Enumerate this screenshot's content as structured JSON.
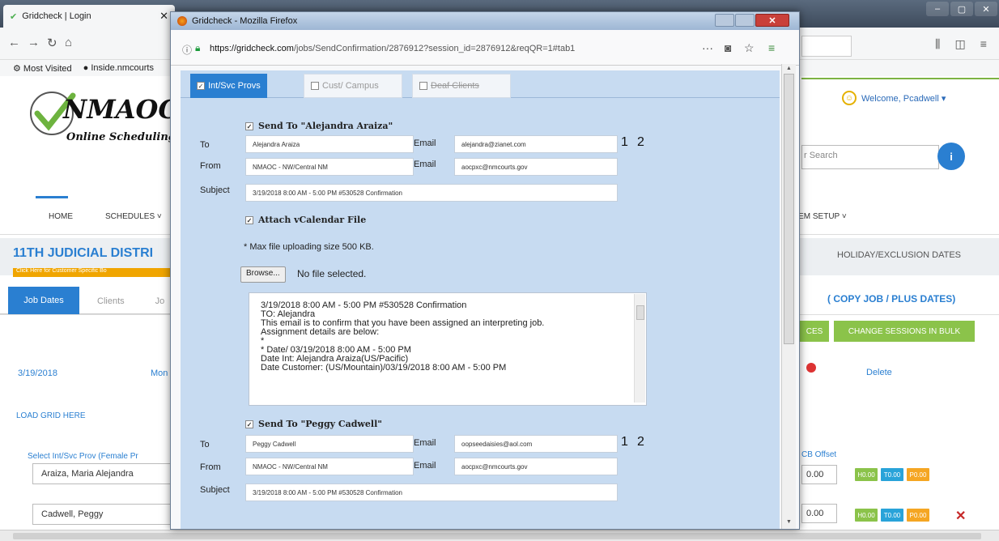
{
  "background": {
    "tab_title": "Gridcheck | Login",
    "tab_close": "✕",
    "bookmarks": [
      "Most Visited",
      "Inside.nmcourts"
    ],
    "logo_text": "NMAOC",
    "logo_tagline": "Online Scheduling &",
    "welcome": "Welcome, Pcadwell ▾",
    "search_placeholder": "r Search",
    "search_btn": "i",
    "menu": {
      "home": "HOME",
      "schedules": "SCHEDULES ˅",
      "system_setup": "TEM SETUP ˅"
    },
    "court_title": "11TH JUDICIAL DISTRI",
    "court_sub": "Click Here for Customer Specific Bo",
    "holiday": "HOLIDAY/EXCLUSION DATES",
    "tabs": {
      "job_dates": "Job Dates",
      "clients": "Clients",
      "more": "Jo"
    },
    "copy_job": "( COPY JOB / PLUS DATES)",
    "btn_ces": "CES",
    "btn_change_sessions": "CHANGE SESSIONS IN BULK",
    "row_date": "3/19/2018",
    "row_day": "Mon",
    "delete": "Delete",
    "load_grid": "LOAD GRID HERE",
    "select_prov": "Select Int/Svc Prov (Female Pr",
    "provider1": "Araiza, Maria Alejandra",
    "provider2": "Cadwell, Peggy",
    "cb_offset": "CB Offset",
    "offset1": "0.00",
    "offset2": "0.00",
    "pills": [
      "H0.00",
      "T0.00",
      "P0.00"
    ]
  },
  "popup": {
    "window_title": "Gridcheck - Mozilla Firefox",
    "url_host": "https://gridcheck.com",
    "url_path": "/jobs/SendConfirmation/2876912?session_id=2876912&reqQR=1#tab1",
    "url_more": "···",
    "tabs": [
      {
        "label": "Int/Svc Provs",
        "checked": true
      },
      {
        "label": "Cust/ Campus",
        "checked": false
      },
      {
        "label": "Deaf Clients",
        "checked": false
      }
    ],
    "labels": {
      "to": "To",
      "from": "From",
      "subject": "Subject",
      "email": "Email"
    },
    "recipient1": {
      "section": "Send To \"Alejandra Araiza\"",
      "to": "Alejandra Araiza",
      "to_email": "alejandra@zianet.com",
      "from": "NMAOC - NW/Central NM",
      "from_email": "aocpxc@nmcourts.gov",
      "subject": "3/19/2018 8:00 AM - 5:00 PM #530528 Confirmation"
    },
    "attach": "Attach vCalendar File",
    "max_size": "* Max file uploading size 500 KB.",
    "browse": "Browse...",
    "no_file": "No file selected.",
    "message_lines": [
      "3/19/2018 8:00 AM - 5:00 PM #530528 Confirmation",
      "TO:  Alejandra",
      "This email is to confirm that you have been assigned an interpreting job.",
      "Assignment details are below:",
      "*",
      "*  Date/ 03/19/2018 8:00 AM - 5:00 PM",
      "Date Int: Alejandra Araiza(US/Pacific)",
      "Date Customer: (US/Mountain)/03/19/2018 8:00 AM - 5:00 PM"
    ],
    "recipient2": {
      "section": "Send To \"Peggy Cadwell\"",
      "to": "Peggy Cadwell",
      "to_email": "oopseedaisies@aol.com",
      "from": "NMAOC - NW/Central NM",
      "from_email": "aocpxc@nmcourts.gov",
      "subject": "3/19/2018 8:00 AM - 5:00 PM #530528 Confirmation"
    },
    "nums": [
      "1",
      "2"
    ]
  },
  "colors": {
    "accent": "#2a7fd1",
    "green": "#8bc34a",
    "popup_bg": "#c7dbf1"
  }
}
